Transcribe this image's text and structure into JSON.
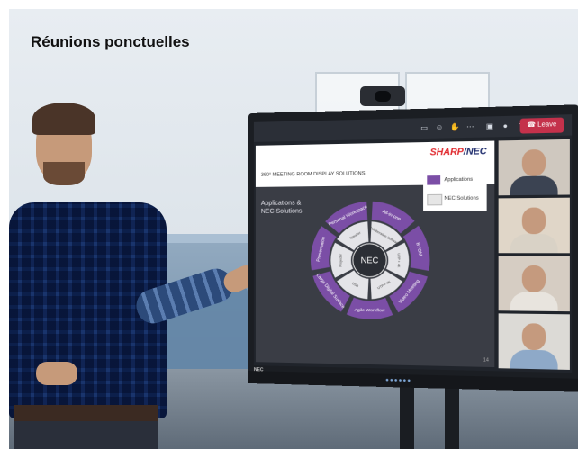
{
  "heading": {
    "text": "Réunions ponctuelles"
  },
  "teams": {
    "leave_label": "Leave",
    "toolbar_icons": [
      "chat-icon",
      "people-icon",
      "react-icon",
      "more-icon",
      "camera-icon",
      "mic-icon",
      "share-icon"
    ]
  },
  "slide": {
    "title": "360° MEETING ROOM DISPLAY SOLUTIONS",
    "subtitle": "Applications & NEC Solutions",
    "brand_a": "SHARP",
    "brand_b": "/NEC",
    "center_label": "NEC",
    "legend": {
      "applications": "Applications",
      "nec_solutions": "NEC Solutions"
    },
    "outer_segments": [
      "All-in-one",
      "BYOM",
      "Video Meeting",
      "Agile Workflow",
      "Large Digital Surface",
      "Presentation",
      "Personal Workspace"
    ],
    "inner_segments": [
      "Collaboration Software",
      "UTP + 4K",
      "UTP + 4K",
      "USB",
      "Projector",
      "Speaker"
    ],
    "page_number": "14"
  },
  "monitor_tag": "NEC",
  "colors": {
    "purple": "#7b4ea6",
    "leave_red": "#c4314b",
    "brand_red": "#e0262b",
    "brand_blue": "#1c2a6b"
  }
}
